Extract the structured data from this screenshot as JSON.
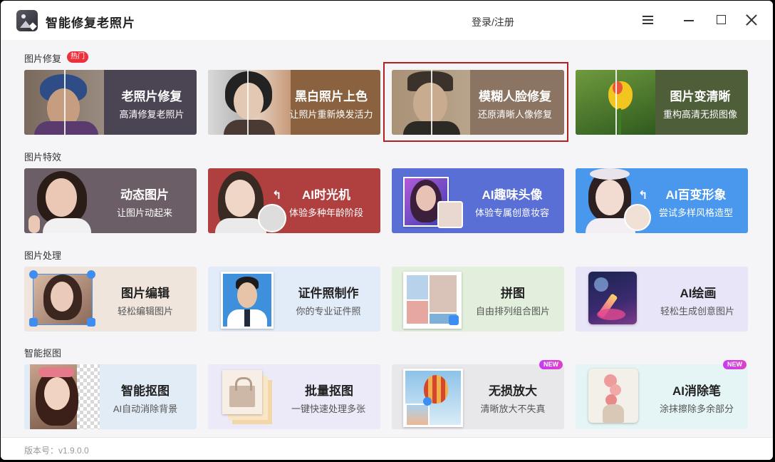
{
  "app": {
    "title": "智能修复老照片",
    "login": "登录/注册",
    "version": "版本号：v1.9.0.0"
  },
  "sections": {
    "repair": {
      "title": "图片修复",
      "badge": "热门"
    },
    "effects": {
      "title": "图片特效"
    },
    "process": {
      "title": "图片处理"
    },
    "cutout": {
      "title": "智能抠图"
    }
  },
  "cards": {
    "old_photo": {
      "title": "老照片修复",
      "subtitle": "高清修复老照片"
    },
    "colorize": {
      "title": "黑白照片上色",
      "subtitle": "让照片重新焕发活力"
    },
    "blur_face": {
      "title": "模糊人脸修复",
      "subtitle": "还原清晰人像修复"
    },
    "sharpen": {
      "title": "图片变清晰",
      "subtitle": "重构高清无损图像"
    },
    "animate": {
      "title": "动态图片",
      "subtitle": "让图片动起来"
    },
    "time_machine": {
      "title": "AI时光机",
      "subtitle": "体验多种年龄阶段"
    },
    "fun_avatar": {
      "title": "AI趣味头像",
      "subtitle": "体验专属创意妆容"
    },
    "transform": {
      "title": "AI百变形象",
      "subtitle": "尝试多样风格造型"
    },
    "edit": {
      "title": "图片编辑",
      "subtitle": "轻松编辑图片"
    },
    "id_photo": {
      "title": "证件照制作",
      "subtitle": "你的专业证件照"
    },
    "collage": {
      "title": "拼图",
      "subtitle": "自由排列组合图片"
    },
    "ai_paint": {
      "title": "AI绘画",
      "subtitle": "轻松生成创意图片"
    },
    "smart_cutout": {
      "title": "智能抠图",
      "subtitle": "AI自动消除背景"
    },
    "batch_cutout": {
      "title": "批量抠图",
      "subtitle": "一键快速处理多张"
    },
    "upscale": {
      "title": "无损放大",
      "subtitle": "清晰放大不失真",
      "badge": "NEW"
    },
    "eraser": {
      "title": "AI消除笔",
      "subtitle": "涂抹擦除多余部分",
      "badge": "NEW"
    }
  }
}
